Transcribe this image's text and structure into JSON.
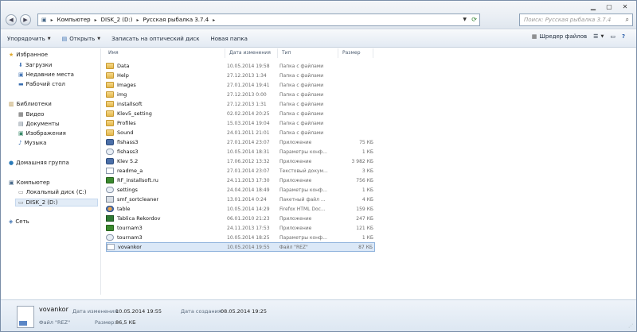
{
  "window": {
    "minimize_icon": "minimize-icon",
    "maximize_icon": "maximize-icon",
    "close_icon": "close-icon"
  },
  "address": {
    "crumbs": [
      "Компьютер",
      "DISK_2 (D:)",
      "Русская рыбалка 3.7.4"
    ]
  },
  "search": {
    "placeholder": "Поиск: Русская рыбалка 3.7.4"
  },
  "toolbar": {
    "organize": "Упорядочить",
    "open": "Открыть",
    "burn": "Записать на оптический диск",
    "new_folder": "Новая папка",
    "shredder": "Шредер файлов"
  },
  "nav": {
    "favorites": {
      "label": "Избранное",
      "items": [
        "Загрузки",
        "Недавние места",
        "Рабочий стол"
      ]
    },
    "libraries": {
      "label": "Библиотеки",
      "items": [
        "Видео",
        "Документы",
        "Изображения",
        "Музыка"
      ]
    },
    "homegroup": "Домашняя группа",
    "computer": {
      "label": "Компьютер",
      "items": [
        "Локальный диск (C:)",
        "DISK_2 (D:)"
      ]
    },
    "network": "Сеть"
  },
  "columns": {
    "name": "Имя",
    "date": "Дата изменения",
    "type": "Тип",
    "size": "Размер"
  },
  "files": [
    {
      "name": "Data",
      "date": "10.05.2014 19:58",
      "type": "Папка с файлами",
      "size": "",
      "icon": "folder"
    },
    {
      "name": "Help",
      "date": "27.12.2013 1:34",
      "type": "Папка с файлами",
      "size": "",
      "icon": "folder"
    },
    {
      "name": "Images",
      "date": "27.01.2014 19:41",
      "type": "Папка с файлами",
      "size": "",
      "icon": "folder"
    },
    {
      "name": "img",
      "date": "27.12.2013 0:00",
      "type": "Папка с файлами",
      "size": "",
      "icon": "folder"
    },
    {
      "name": "installsoft",
      "date": "27.12.2013 1:31",
      "type": "Папка с файлами",
      "size": "",
      "icon": "folder"
    },
    {
      "name": "Klev5_setting",
      "date": "02.02.2014 20:25",
      "type": "Папка с файлами",
      "size": "",
      "icon": "folder"
    },
    {
      "name": "Profiles",
      "date": "15.03.2014 19:04",
      "type": "Папка с файлами",
      "size": "",
      "icon": "folder"
    },
    {
      "name": "Sound",
      "date": "24.01.2011 21:01",
      "type": "Папка с файлами",
      "size": "",
      "icon": "folder"
    },
    {
      "name": "fishass3",
      "date": "27.01.2014 23:07",
      "type": "Приложение",
      "size": "75 КБ",
      "icon": "app"
    },
    {
      "name": "fishass3",
      "date": "10.05.2014 18:31",
      "type": "Параметры конф...",
      "size": "1 КБ",
      "icon": "cfg"
    },
    {
      "name": "Klev 5.2",
      "date": "17.06.2012 13:32",
      "type": "Приложение",
      "size": "3 982 КБ",
      "icon": "app"
    },
    {
      "name": "readme_a",
      "date": "27.01.2014 23:07",
      "type": "Текстовый докум...",
      "size": "3 КБ",
      "icon": "txt"
    },
    {
      "name": "RF_installsoft.ru",
      "date": "24.11.2013 17:30",
      "type": "Приложение",
      "size": "756 КБ",
      "icon": "grn"
    },
    {
      "name": "settings",
      "date": "24.04.2014 18:49",
      "type": "Параметры конф...",
      "size": "1 КБ",
      "icon": "cfg"
    },
    {
      "name": "smf_sortcleaner",
      "date": "13.01.2014 0:24",
      "type": "Пакетный файл ...",
      "size": "4 КБ",
      "icon": "bat"
    },
    {
      "name": "table",
      "date": "10.05.2014 14:29",
      "type": "Firefox HTML Doc...",
      "size": "159 КБ",
      "icon": "ff"
    },
    {
      "name": "Tablica Rekordov",
      "date": "06.01.2010 21:23",
      "type": "Приложение",
      "size": "247 КБ",
      "icon": "xl"
    },
    {
      "name": "tournam3",
      "date": "24.11.2013 17:53",
      "type": "Приложение",
      "size": "121 КБ",
      "icon": "grn"
    },
    {
      "name": "tournam3",
      "date": "10.05.2014 18:25",
      "type": "Параметры конф...",
      "size": "1 КБ",
      "icon": "cfg"
    },
    {
      "name": "vovankor",
      "date": "10.05.2014 19:55",
      "type": "Файл \"REZ\"",
      "size": "87 КБ",
      "icon": "rez"
    }
  ],
  "details": {
    "name": "vovankor",
    "type": "Файл \"REZ\"",
    "modified_label": "Дата изменения:",
    "modified": "10.05.2014 19:55",
    "created_label": "Дата создания:",
    "created": "08.05.2014 19:25",
    "size_label": "Размер:",
    "size": "86,5 КБ"
  }
}
